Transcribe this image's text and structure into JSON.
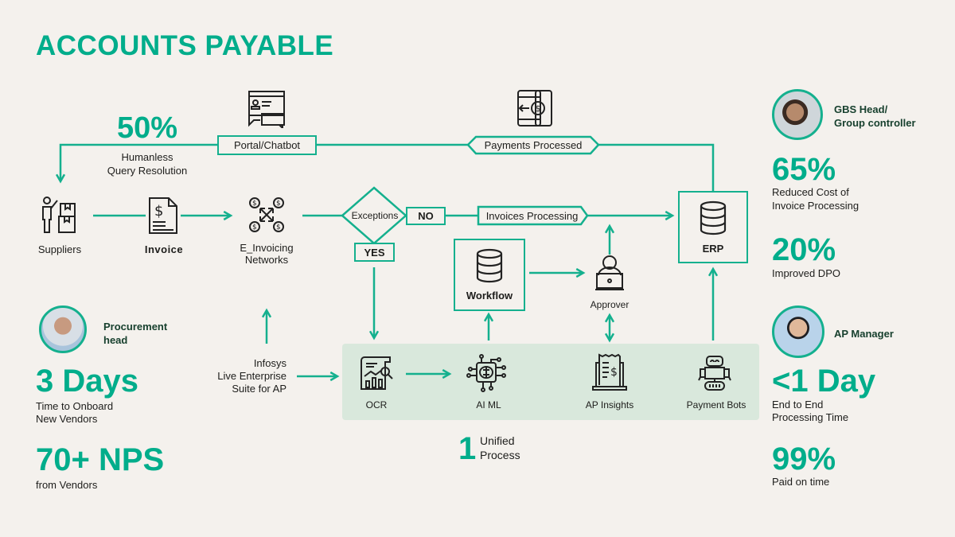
{
  "title": "ACCOUNTS PAYABLE",
  "colors": {
    "accent": "#00ad8b",
    "line": "#14b08e",
    "background": "#f4f1ed",
    "panel": "#d9e8dc",
    "role_text": "#17402e"
  },
  "top_stat": {
    "value": "50%",
    "label_line1": "Humanless",
    "label_line2": "Query Resolution"
  },
  "flow": {
    "portal": {
      "label": "Portal/Chatbot",
      "icon": "chat-window-icon"
    },
    "payments": {
      "label": "Payments Processed",
      "icon": "mobile-payment-icon"
    },
    "suppliers": {
      "label": "Suppliers",
      "icon": "supplier-boxes-icon"
    },
    "invoice": {
      "label": "Invoice",
      "icon": "invoice-document-icon"
    },
    "einvoicing": {
      "label_line1": "E_Invoicing",
      "label_line2": "Networks",
      "icon": "network-dollar-icon"
    },
    "exceptions": {
      "label": "Exceptions"
    },
    "no": {
      "label": "NO"
    },
    "yes": {
      "label": "YES"
    },
    "invoices_processing": {
      "label": "Invoices Processing"
    },
    "workflow": {
      "label": "Workflow",
      "icon": "database-icon"
    },
    "approver": {
      "label": "Approver",
      "icon": "person-laptop-icon"
    },
    "erp": {
      "label": "ERP",
      "icon": "database-icon"
    },
    "infosys": {
      "line1": "Infosys",
      "line2": "Live Enterprise",
      "line3": "Suite for AP"
    },
    "suite": [
      {
        "label": "OCR",
        "icon": "ocr-chart-icon"
      },
      {
        "label": "AI ML",
        "icon": "brain-chip-icon"
      },
      {
        "label": "AP Insights",
        "icon": "laptop-receipt-icon"
      },
      {
        "label": "Payment Bots",
        "icon": "robot-icon"
      }
    ],
    "unified": {
      "number": "1",
      "line1": "Unified",
      "line2": "Process"
    }
  },
  "left": {
    "persona": {
      "role_line1": "Procurement",
      "role_line2": "head"
    },
    "stats": [
      {
        "value": "3 Days",
        "line1": "Time to Onboard",
        "line2": "New Vendors"
      },
      {
        "value": "70+ NPS",
        "line1": "from Vendors",
        "line2": ""
      }
    ]
  },
  "right": {
    "persona_top": {
      "role_line1": "GBS Head/",
      "role_line2": "Group controller"
    },
    "stats_top": [
      {
        "value": "65%",
        "line1": "Reduced Cost of",
        "line2": "Invoice Processing"
      },
      {
        "value": "20%",
        "line1": "Improved DPO",
        "line2": ""
      }
    ],
    "persona_bottom": {
      "role_line1": "AP Manager"
    },
    "stats_bottom": [
      {
        "value": "<1 Day",
        "line1": "End to End",
        "line2": "Processing Time"
      },
      {
        "value": "99%",
        "line1": "Paid on time",
        "line2": ""
      }
    ]
  }
}
